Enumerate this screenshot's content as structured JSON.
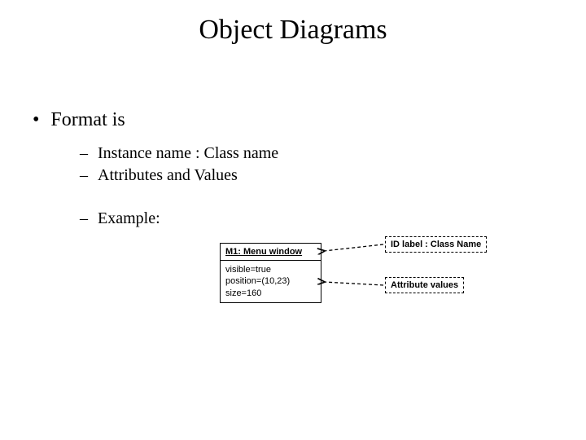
{
  "title": "Object Diagrams",
  "bullets": {
    "main": "Format is",
    "sub": [
      "Instance name : Class name",
      "Attributes and Values",
      "Example:"
    ]
  },
  "example": {
    "object": {
      "header": "M1: Menu window",
      "attr1": "visible=true",
      "attr2": "position=(10,23)",
      "attr3": "size=160"
    },
    "callouts": {
      "idlabel": "ID label : Class Name",
      "attrvals": "Attribute values"
    }
  }
}
